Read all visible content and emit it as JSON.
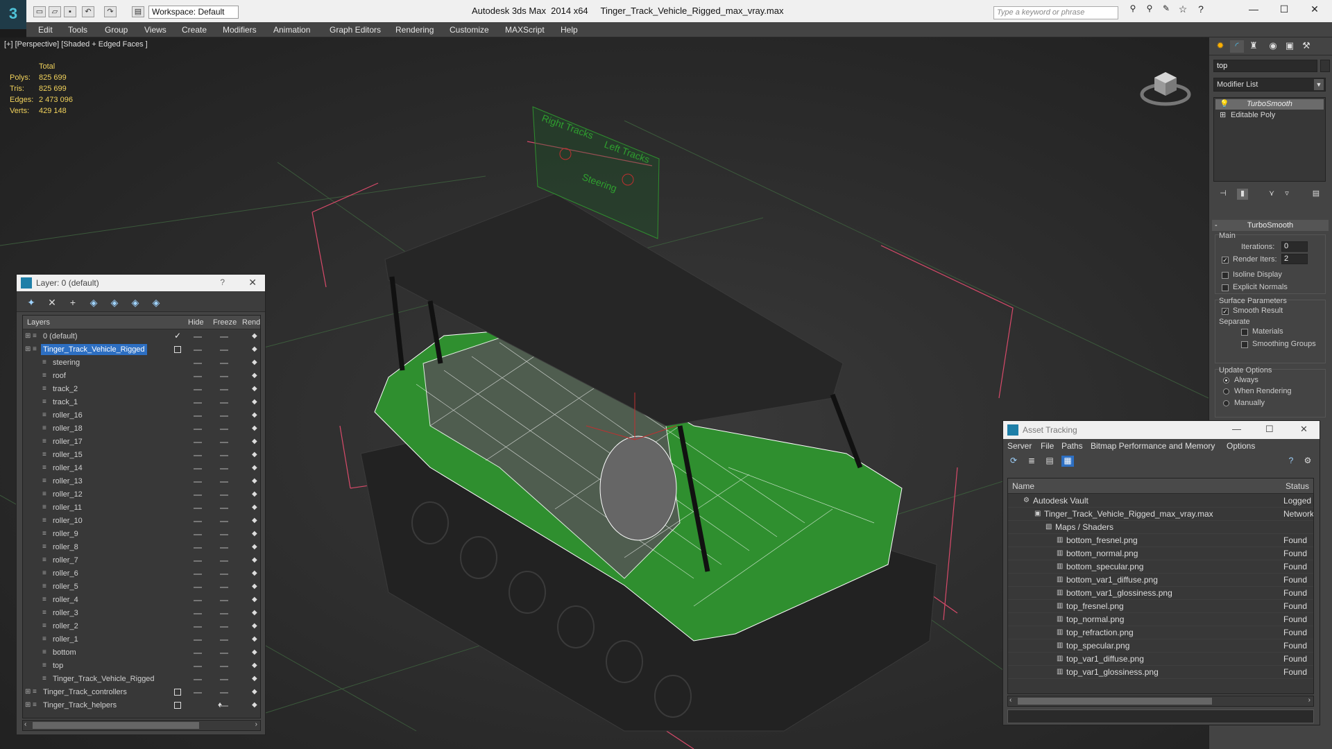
{
  "app": {
    "title": "Autodesk 3ds Max  2014 x64     Tinger_Track_Vehicle_Rigged_max_vray.max",
    "workspace": "Workspace: Default",
    "search_placeholder": "Type a keyword or phrase"
  },
  "menu": [
    "Edit",
    "Tools",
    "Group",
    "Views",
    "Create",
    "Modifiers",
    "Animation",
    "Graph Editors",
    "Rendering",
    "Customize",
    "MAXScript",
    "Help"
  ],
  "viewport": {
    "label": "[+] [Perspective] [Shaded + Edged Faces ]",
    "stats": {
      "total_label": "Total",
      "rows": [
        {
          "k": "Polys:",
          "v": "825 699"
        },
        {
          "k": "Tris:",
          "v": "825 699"
        },
        {
          "k": "Edges:",
          "v": "2 473 096"
        },
        {
          "k": "Verts:",
          "v": "429 148"
        }
      ]
    },
    "gizmo_labels": [
      "Right Tracks",
      "Left Tracks",
      "Steering"
    ]
  },
  "layer_window": {
    "title": "Layer: 0 (default)",
    "help": "?",
    "close": "✕",
    "columns": [
      "Layers",
      "Hide",
      "Freeze",
      "Rende"
    ],
    "rows": [
      {
        "name": "0 (default)",
        "indent": 0,
        "flag": "check"
      },
      {
        "name": "Tinger_Track_Vehicle_Rigged",
        "indent": 0,
        "flag": "box",
        "selected": true
      },
      {
        "name": "steering",
        "indent": 1
      },
      {
        "name": "roof",
        "indent": 1
      },
      {
        "name": "track_2",
        "indent": 1
      },
      {
        "name": "track_1",
        "indent": 1
      },
      {
        "name": "roller_16",
        "indent": 1
      },
      {
        "name": "roller_18",
        "indent": 1
      },
      {
        "name": "roller_17",
        "indent": 1
      },
      {
        "name": "roller_15",
        "indent": 1
      },
      {
        "name": "roller_14",
        "indent": 1
      },
      {
        "name": "roller_13",
        "indent": 1
      },
      {
        "name": "roller_12",
        "indent": 1
      },
      {
        "name": "roller_11",
        "indent": 1
      },
      {
        "name": "roller_10",
        "indent": 1
      },
      {
        "name": "roller_9",
        "indent": 1
      },
      {
        "name": "roller_8",
        "indent": 1
      },
      {
        "name": "roller_7",
        "indent": 1
      },
      {
        "name": "roller_6",
        "indent": 1
      },
      {
        "name": "roller_5",
        "indent": 1
      },
      {
        "name": "roller_4",
        "indent": 1
      },
      {
        "name": "roller_3",
        "indent": 1
      },
      {
        "name": "roller_2",
        "indent": 1
      },
      {
        "name": "roller_1",
        "indent": 1
      },
      {
        "name": "bottom",
        "indent": 1
      },
      {
        "name": "top",
        "indent": 1
      },
      {
        "name": "Tinger_Track_Vehicle_Rigged",
        "indent": 1
      },
      {
        "name": "Tinger_Track_controllers",
        "indent": 0,
        "flag": "box"
      },
      {
        "name": "Tinger_Track_helpers",
        "indent": 0,
        "flag": "box",
        "bulb": true
      }
    ]
  },
  "command_panel": {
    "object_name": "top",
    "modifier_list": "Modifier List",
    "stack": [
      "TurboSmooth",
      "Editable Poly"
    ],
    "turbosmooth": {
      "rollout_title": "TurboSmooth",
      "main_label": "Main",
      "iterations_label": "Iterations:",
      "iterations_value": "0",
      "render_iters_label": "Render Iters:",
      "render_iters_value": "2",
      "isoline_label": "Isoline Display",
      "explicit_label": "Explicit Normals",
      "surface_label": "Surface Parameters",
      "smooth_result_label": "Smooth Result",
      "separate_label": "Separate",
      "materials_label": "Materials",
      "smoothing_groups_label": "Smoothing Groups",
      "update_label": "Update Options",
      "always_label": "Always",
      "when_rendering_label": "When Rendering",
      "manually_label": "Manually"
    }
  },
  "asset_window": {
    "title": "Asset Tracking",
    "menu": [
      "Server",
      "File",
      "Paths",
      "Bitmap Performance and Memory",
      "Options"
    ],
    "columns": [
      "Name",
      "Status"
    ],
    "rows": [
      {
        "name": "Autodesk Vault",
        "status": "Logged O",
        "indent": 0
      },
      {
        "name": "Tinger_Track_Vehicle_Rigged_max_vray.max",
        "status": "Network",
        "indent": 1
      },
      {
        "name": "Maps / Shaders",
        "status": "",
        "indent": 2
      },
      {
        "name": "bottom_fresnel.png",
        "status": "Found",
        "indent": 3
      },
      {
        "name": "bottom_normal.png",
        "status": "Found",
        "indent": 3
      },
      {
        "name": "bottom_specular.png",
        "status": "Found",
        "indent": 3
      },
      {
        "name": "bottom_var1_diffuse.png",
        "status": "Found",
        "indent": 3
      },
      {
        "name": "bottom_var1_glossiness.png",
        "status": "Found",
        "indent": 3
      },
      {
        "name": "top_fresnel.png",
        "status": "Found",
        "indent": 3
      },
      {
        "name": "top_normal.png",
        "status": "Found",
        "indent": 3
      },
      {
        "name": "top_refraction.png",
        "status": "Found",
        "indent": 3
      },
      {
        "name": "top_specular.png",
        "status": "Found",
        "indent": 3
      },
      {
        "name": "top_var1_diffuse.png",
        "status": "Found",
        "indent": 3
      },
      {
        "name": "top_var1_glossiness.png",
        "status": "Found",
        "indent": 3
      }
    ]
  },
  "colors": {
    "wire_green": "#2f8f2f",
    "selection_blue": "#2d6fc2",
    "stats_yellow": "#f2d35c",
    "helper_pink": "#e05070"
  }
}
